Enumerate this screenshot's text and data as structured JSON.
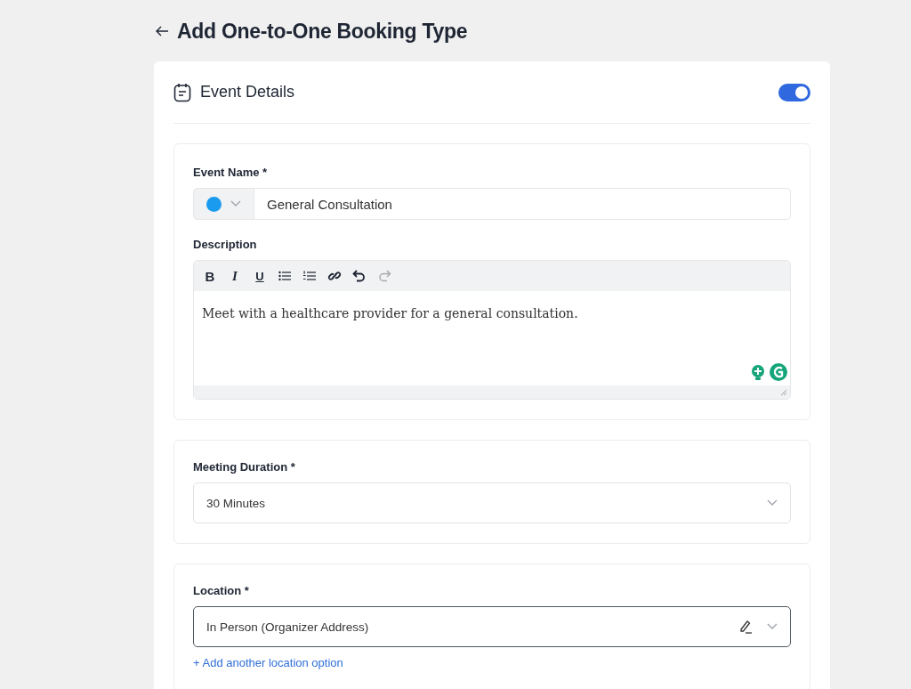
{
  "page": {
    "title": "Add One-to-One Booking Type"
  },
  "card": {
    "title": "Event Details",
    "enabled": true
  },
  "event_name": {
    "label": "Event Name *",
    "color": "#1a9bf0",
    "value": "General Consultation"
  },
  "description": {
    "label": "Description",
    "toolbar": [
      {
        "kind": "bold",
        "label": "B",
        "disabled": false
      },
      {
        "kind": "italic",
        "label": "I",
        "disabled": false
      },
      {
        "kind": "underline",
        "label": "U",
        "disabled": false
      },
      {
        "kind": "bullets",
        "disabled": false
      },
      {
        "kind": "numbers",
        "disabled": false
      },
      {
        "kind": "link",
        "disabled": false
      },
      {
        "kind": "undo",
        "disabled": false
      },
      {
        "kind": "redo",
        "disabled": true
      }
    ],
    "text": "Meet with a healthcare provider for a general consultation."
  },
  "duration": {
    "label": "Meeting Duration *",
    "value": "30 Minutes"
  },
  "location": {
    "label": "Location *",
    "value": "In Person (Organizer Address)",
    "add_link": "+ Add another location option"
  }
}
